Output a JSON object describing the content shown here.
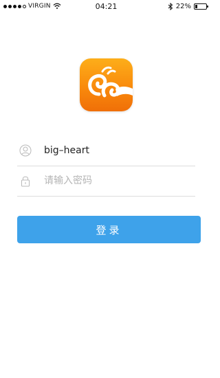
{
  "status_bar": {
    "carrier": "VIRGIN",
    "time": "04:21",
    "battery_text": "22%",
    "battery_level": 0.22,
    "icons": [
      "signal-dots-icon",
      "wifi-icon",
      "bluetooth-icon",
      "battery-icon"
    ]
  },
  "app": {
    "icon_name": "app-logo-icon",
    "colors": {
      "icon_gradient_top": "#fdae1a",
      "icon_gradient_bottom": "#f06f08",
      "accent": "#3ea2ea"
    }
  },
  "form": {
    "username": {
      "icon": "user-icon",
      "value": "big–heart",
      "placeholder": ""
    },
    "password": {
      "icon": "lock-icon",
      "value": "",
      "placeholder": "请输入密码"
    },
    "submit_label": "登录"
  }
}
